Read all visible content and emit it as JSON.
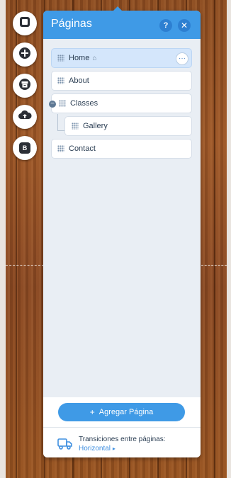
{
  "panel": {
    "title": "Páginas",
    "help_label": "?",
    "close_label": "✕"
  },
  "pages": [
    {
      "label": "Home",
      "home_icon": "⌂",
      "more_label": "···"
    },
    {
      "label": "About"
    },
    {
      "label": "Classes",
      "collapse_label": "−"
    },
    {
      "label": "Gallery"
    },
    {
      "label": "Contact"
    }
  ],
  "footer": {
    "add_button_plus": "+",
    "add_button_label": "Agregar Página",
    "transitions_label": "Transiciones entre páginas:",
    "transitions_value": "Horizontal",
    "transitions_arrow": "▸"
  },
  "rail": {
    "icons": [
      "square-frame-icon",
      "add-circle-icon",
      "store-icon",
      "upload-cloud-icon",
      "blog-icon"
    ],
    "blog_letter": "B"
  },
  "colors": {
    "accent": "#3f9ae6",
    "selected_row": "#d4e6fb",
    "panel_bg": "#e9eef4"
  }
}
